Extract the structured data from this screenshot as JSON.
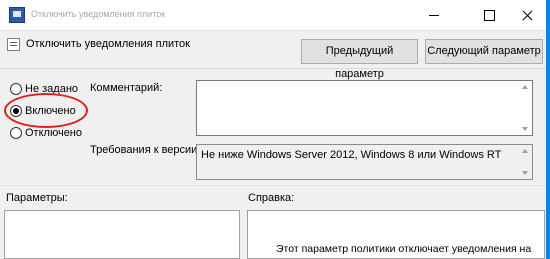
{
  "window": {
    "icon": "group-policy-icon",
    "title": "Отключить уведомления плиток",
    "controls": [
      "minimize-icon",
      "maximize-icon",
      "close-icon"
    ]
  },
  "header": {
    "setting_title": "Отключить уведомления плиток",
    "prev_button": "Предыдущий параметр",
    "next_button": "Следующий параметр"
  },
  "state": {
    "options": [
      {
        "label": "Не задано",
        "checked": false
      },
      {
        "label": "Включено",
        "checked": true
      },
      {
        "label": "Отключено",
        "checked": false
      }
    ],
    "highlight_color": "#e21d1d"
  },
  "comment": {
    "label": "Комментарий:",
    "value": ""
  },
  "requirements": {
    "label": "Требования к версии:",
    "value": "Не ниже Windows Server 2012, Windows 8 или Windows RT"
  },
  "panels": {
    "params_label": "Параметры:",
    "help_label": "Справка:",
    "help_text": "Этот параметр политики отключает уведомления на"
  },
  "accent": "#1683d8"
}
